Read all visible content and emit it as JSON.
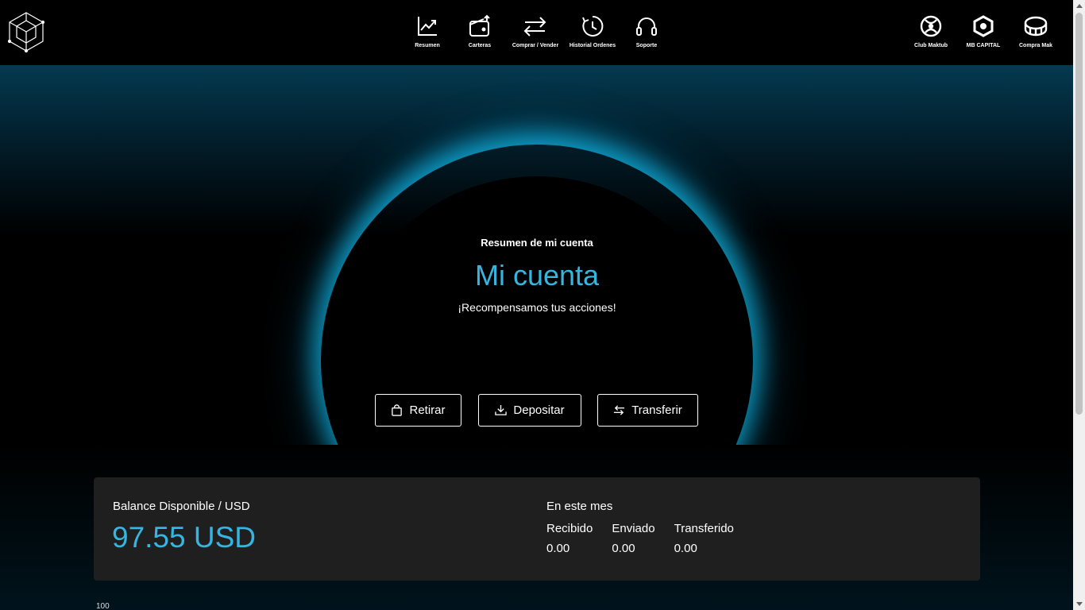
{
  "nav": {
    "center": [
      {
        "label": "Resumen",
        "icon": "chart-line-icon"
      },
      {
        "label": "Carteras",
        "icon": "wallet-icon"
      },
      {
        "label": "Comprar / Vender",
        "icon": "swap-arrows-icon"
      },
      {
        "label": "Historial Ordenes",
        "icon": "history-clock-icon"
      },
      {
        "label": "Soporte",
        "icon": "headset-icon"
      }
    ],
    "right": [
      {
        "label": "Club Maktub",
        "icon": "club-maktub-icon"
      },
      {
        "label": "MB CAPITAL",
        "icon": "mb-capital-icon"
      },
      {
        "label": "Compra Mak",
        "icon": "coin-icon"
      }
    ]
  },
  "hero": {
    "subtitle": "Resumen de mi cuenta",
    "title": "Mi cuenta",
    "tagline": "¡Recompensamos tus acciones!"
  },
  "actions": {
    "withdraw": "Retirar",
    "deposit": "Depositar",
    "transfer": "Transferir"
  },
  "balance": {
    "label": "Balance Disponible / USD",
    "value": "97.55 USD",
    "month_label": "En este mes",
    "stats": [
      {
        "label": "Recibido",
        "value": "0.00"
      },
      {
        "label": "Enviado",
        "value": "0.00"
      },
      {
        "label": "Transferido",
        "value": "0.00"
      }
    ]
  },
  "chart_axis": {
    "tick": "100"
  },
  "colors": {
    "accent": "#35b5e0",
    "card": "#1f1f1f",
    "glow": "#0faad7"
  }
}
